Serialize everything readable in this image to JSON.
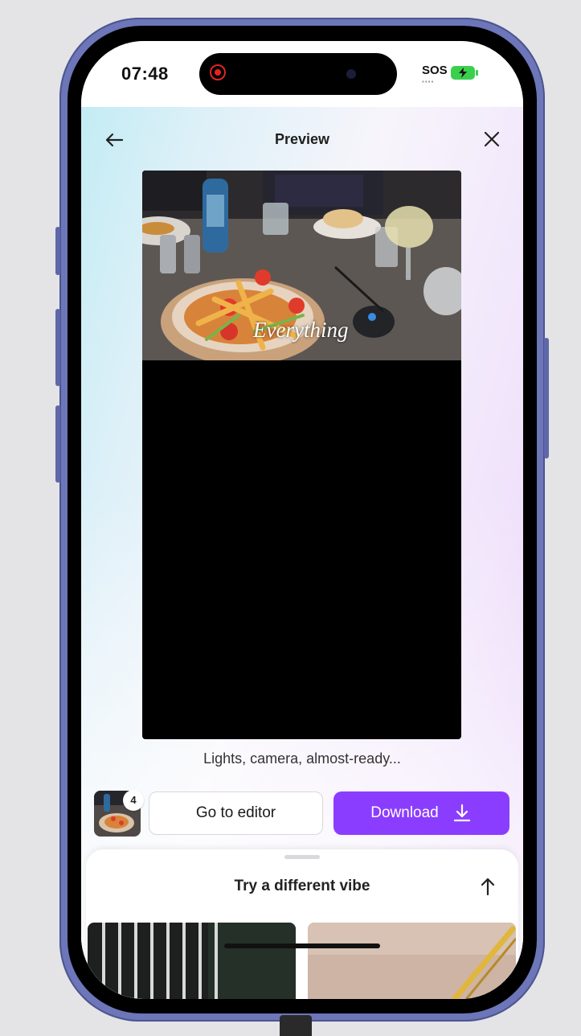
{
  "status_bar": {
    "time": "07:48",
    "sos": "SOS",
    "recording_color": "#e02424",
    "battery_color": "#3ccf4e"
  },
  "header": {
    "title": "Preview",
    "back_icon": "arrow-left-icon",
    "close_icon": "close-icon"
  },
  "preview": {
    "caption": "Everything"
  },
  "status_message": "Lights, camera, almost-ready...",
  "actions": {
    "thumbnail_count": "4",
    "go_to_editor_label": "Go to editor",
    "download_label": "Download",
    "download_icon": "download-icon",
    "accent_color": "#8b3dff"
  },
  "sheet": {
    "title": "Try a different vibe",
    "expand_icon": "arrow-up-icon"
  }
}
